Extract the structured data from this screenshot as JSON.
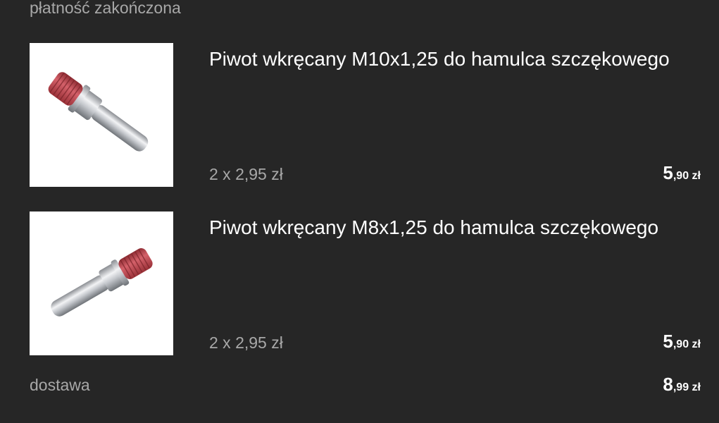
{
  "order": {
    "status": "płatność zakończona"
  },
  "items": [
    {
      "title": "Piwot wkręcany M10x1,25 do hamulca szczękowego",
      "quantity_line": "2 x 2,95 zł",
      "price_main": "5",
      "price_rest": ",90 zł",
      "image_icon": "brake-pivot-bolt-image"
    },
    {
      "title": "Piwot wkręcany M8x1,25 do hamulca szczękowego",
      "quantity_line": "2 x 2,95 zł",
      "price_main": "5",
      "price_rest": ",90 zł",
      "image_icon": "brake-pivot-bolt-image"
    }
  ],
  "delivery": {
    "label": "dostawa",
    "price_main": "8",
    "price_rest": ",99 zł"
  },
  "colors": {
    "background": "#262626",
    "primary_text": "#ffffff",
    "secondary_text": "#a8a8a8",
    "thread_red": "#c03d44"
  }
}
